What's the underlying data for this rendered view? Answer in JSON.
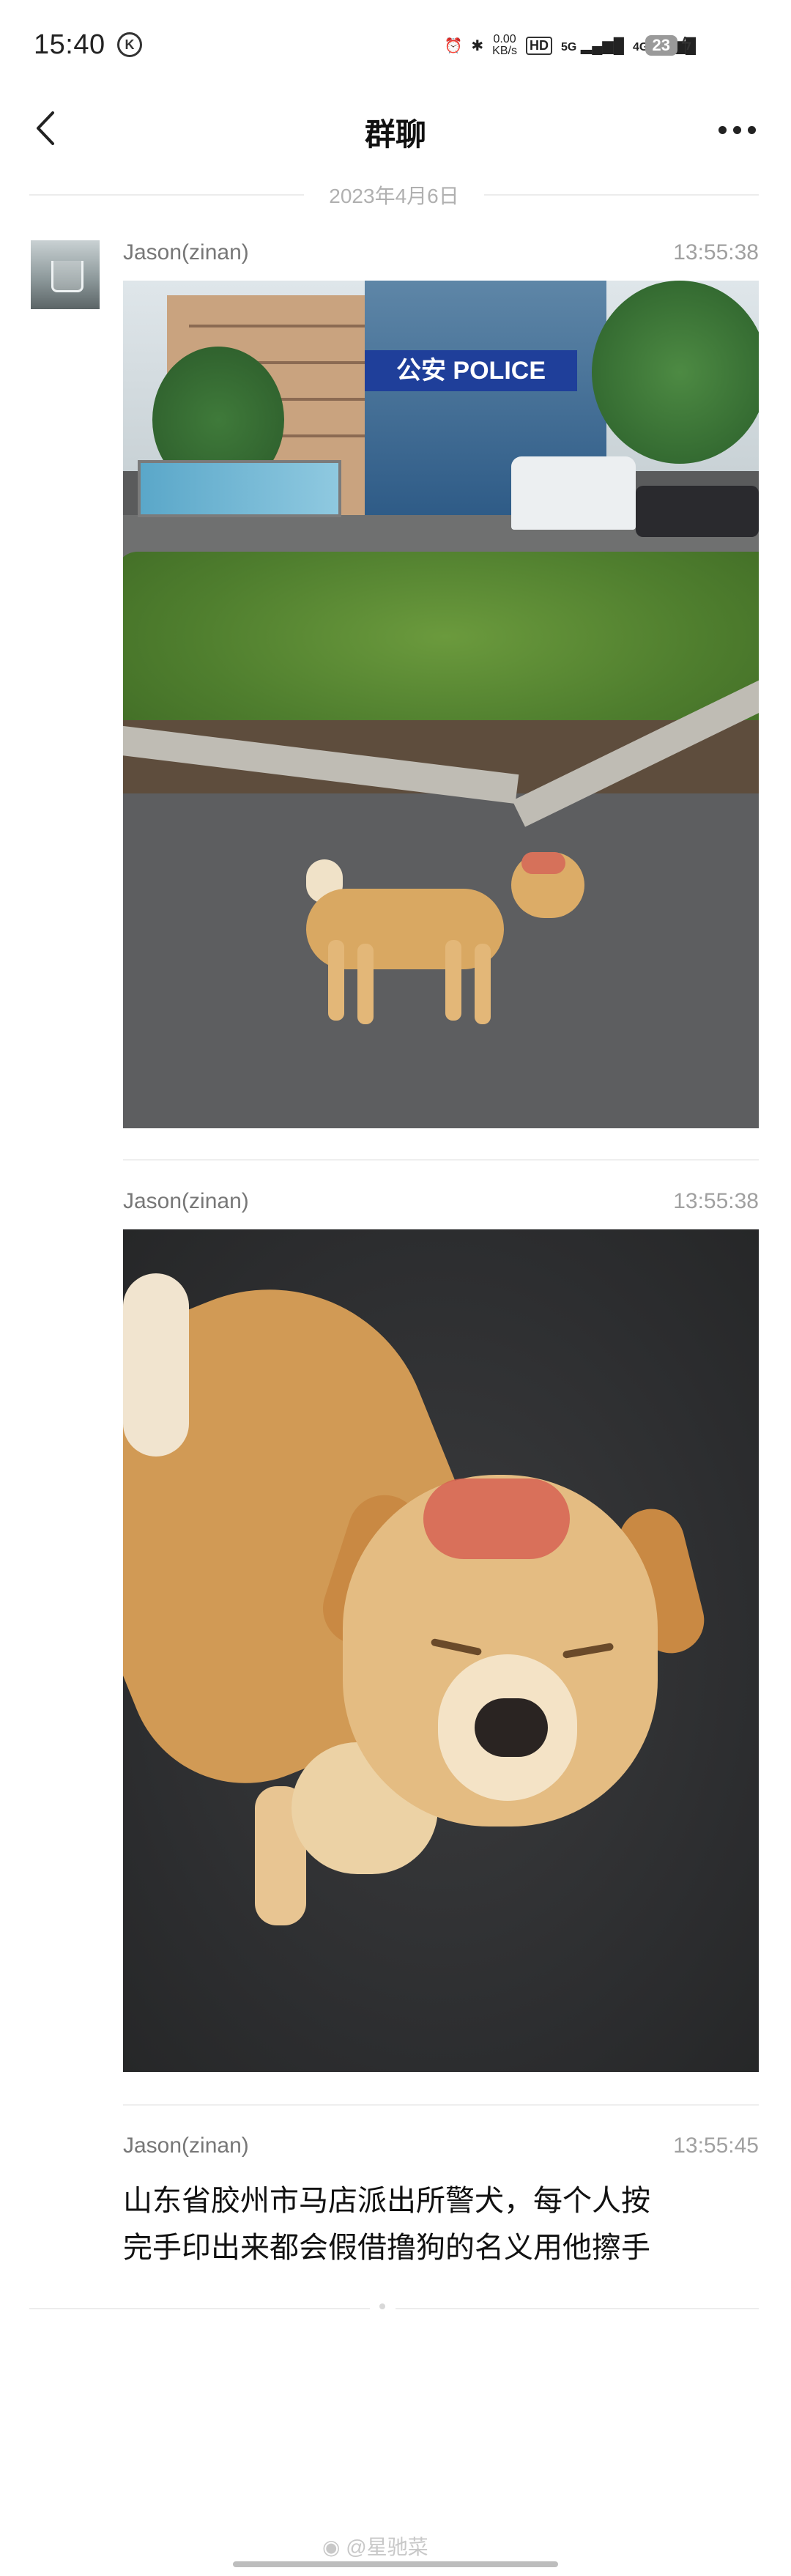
{
  "status_bar": {
    "time": "15:40",
    "k_badge": "K",
    "network_speed_value": "0.00",
    "network_speed_unit": "KB/s",
    "hd_label": "HD",
    "signal_5g": "5G",
    "signal_4g": "4G",
    "battery": "23"
  },
  "nav": {
    "title": "群聊"
  },
  "date_divider": "2023年4月6日",
  "messages": [
    {
      "sender": "Jason(zinan)",
      "time": "13:55:38",
      "kind": "image"
    },
    {
      "sender": "Jason(zinan)",
      "time": "13:55:38",
      "kind": "image"
    },
    {
      "sender": "Jason(zinan)",
      "time": "13:55:45",
      "kind": "text",
      "text_line_1": "山东省胶州市马店派出所警犬，每个人按",
      "text_line_2": "完手印出来都会假借撸狗的名义用他擦手"
    }
  ],
  "photo1": {
    "sign_text": "公安 POLICE"
  },
  "watermark": "@星驰菜",
  "colors": {
    "background": "#ffffff",
    "meta_text": "#a0a0a0",
    "name_text": "#777777"
  }
}
